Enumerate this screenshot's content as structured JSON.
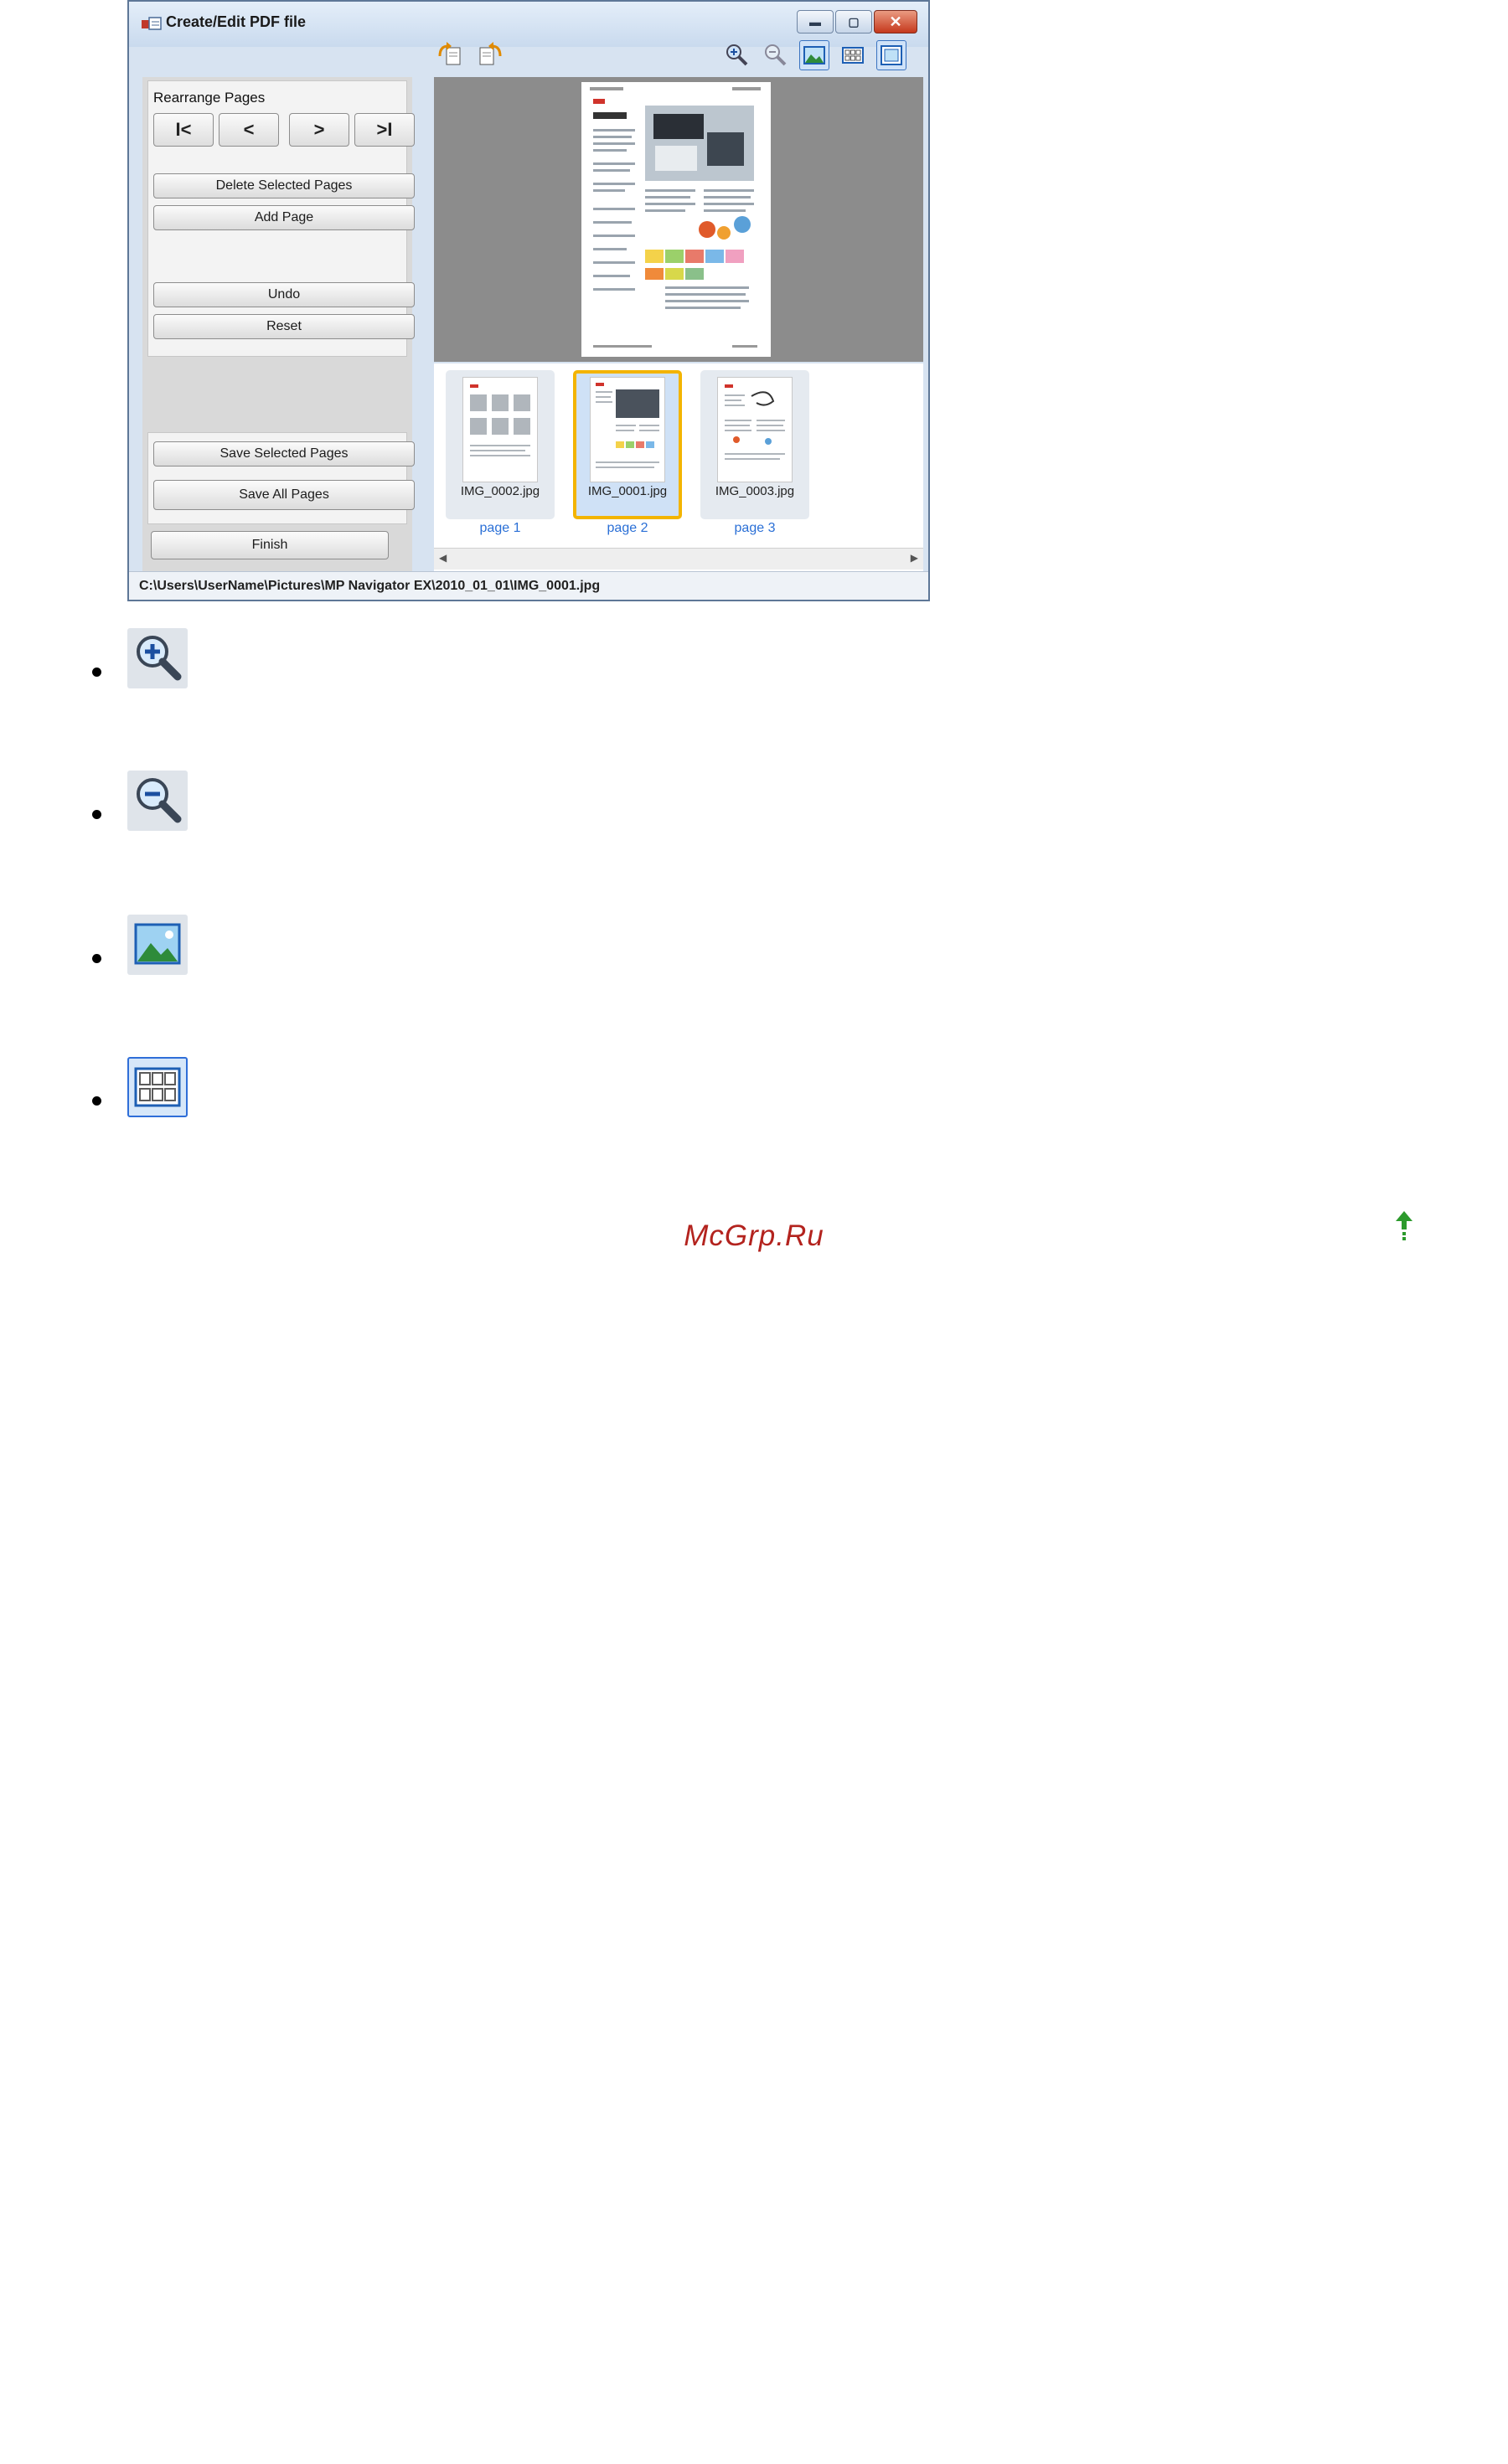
{
  "window": {
    "title": "Create/Edit PDF file"
  },
  "left_panel": {
    "rearrange_label": "Rearrange Pages",
    "nav": {
      "first": "I<",
      "prev": "<",
      "next": ">",
      "last": ">I"
    },
    "delete_selected": "Delete Selected Pages",
    "add_page": "Add Page",
    "undo": "Undo",
    "reset": "Reset",
    "save_selected": "Save Selected Pages",
    "save_all": "Save All Pages",
    "finish": "Finish"
  },
  "thumbnails": [
    {
      "file": "IMG_0002.jpg",
      "page": "page 1",
      "selected": false
    },
    {
      "file": "IMG_0001.jpg",
      "page": "page 2",
      "selected": true
    },
    {
      "file": "IMG_0003.jpg",
      "page": "page 3",
      "selected": false
    }
  ],
  "status_bar": {
    "path": "C:\\Users\\UserName\\Pictures\\MP Navigator EX\\2010_01_01\\IMG_0001.jpg"
  },
  "toolbar_icons": [
    "rotate-left-icon",
    "rotate-right-icon",
    "zoom-in-icon",
    "zoom-out-icon",
    "full-image-view-icon",
    "thumbnail-view-icon",
    "fit-window-icon"
  ],
  "bullet_icons": [
    "zoom-in-icon",
    "zoom-out-icon",
    "full-image-view-icon",
    "thumbnail-view-icon"
  ],
  "footer": {
    "brand": "McGrp.Ru"
  },
  "colors": {
    "selection": "#f3b400",
    "link": "#2a6fd6",
    "footer": "#b3231e",
    "back_to_top": "#2c9a2c"
  }
}
